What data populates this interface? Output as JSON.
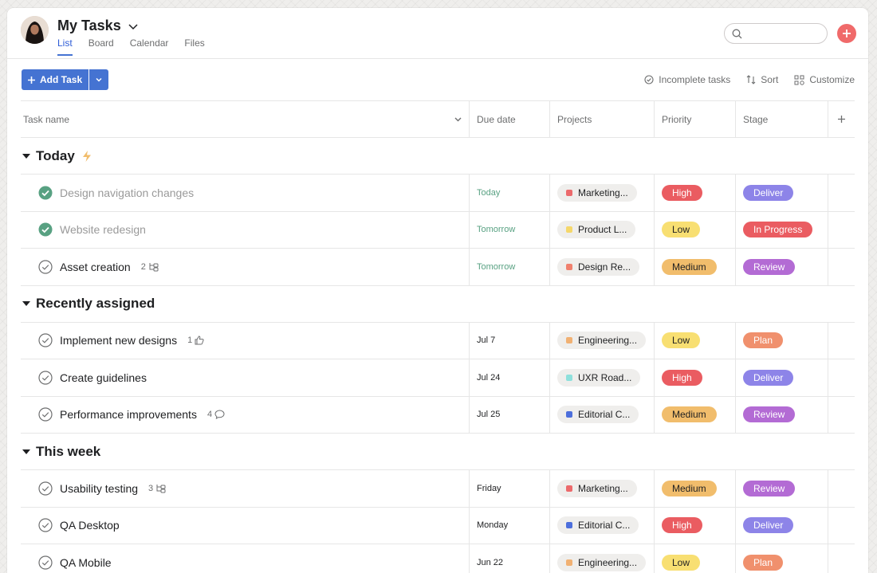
{
  "header": {
    "title": "My Tasks",
    "tabs": [
      "List",
      "Board",
      "Calendar",
      "Files"
    ],
    "active_tab": "List",
    "search_placeholder": ""
  },
  "toolbar": {
    "add_task_label": "Add Task",
    "incomplete_label": "Incomplete tasks",
    "sort_label": "Sort",
    "customize_label": "Customize"
  },
  "columns": {
    "task_name": "Task name",
    "due_date": "Due date",
    "projects": "Projects",
    "priority": "Priority",
    "stage": "Stage"
  },
  "colors": {
    "accent": "#4573d2",
    "add_button": "#f06a6a",
    "done_check": "#58a182"
  },
  "sections": [
    {
      "title": "Today",
      "icon": "lightning-icon",
      "tasks": [
        {
          "name": "Design navigation changes",
          "done": true,
          "meta": "",
          "meta_icon": "",
          "due": "Today",
          "due_green": true,
          "project": "Marketing...",
          "project_color": "#ec6a6c",
          "priority": "High",
          "stage": "Deliver"
        },
        {
          "name": "Website redesign",
          "done": true,
          "meta": "",
          "meta_icon": "",
          "due": "Tomorrow",
          "due_green": true,
          "project": "Product L...",
          "project_color": "#f5d76a",
          "priority": "Low",
          "stage": "In Progress"
        },
        {
          "name": "Asset creation",
          "done": false,
          "meta": "2",
          "meta_icon": "subtask-icon",
          "due": "Tomorrow",
          "due_green": true,
          "project": "Design Re...",
          "project_color": "#f0806d",
          "priority": "Medium",
          "stage": "Review"
        }
      ]
    },
    {
      "title": "Recently assigned",
      "icon": "",
      "tasks": [
        {
          "name": "Implement new designs",
          "done": false,
          "meta": "1",
          "meta_icon": "thumbs-up-icon",
          "due": "Jul 7",
          "due_green": false,
          "project": "Engineering...",
          "project_color": "#f1b173",
          "priority": "Low",
          "stage": "Plan"
        },
        {
          "name": "Create guidelines",
          "done": false,
          "meta": "",
          "meta_icon": "",
          "due": "Jul 24",
          "due_green": false,
          "project": "UXR Road...",
          "project_color": "#8ee0dc",
          "priority": "High",
          "stage": "Deliver"
        },
        {
          "name": "Performance improvements",
          "done": false,
          "meta": "4",
          "meta_icon": "comment-icon",
          "due": "Jul 25",
          "due_green": false,
          "project": "Editorial C...",
          "project_color": "#4d6fdc",
          "priority": "Medium",
          "stage": "Review"
        }
      ]
    },
    {
      "title": "This week",
      "icon": "",
      "tasks": [
        {
          "name": "Usability testing",
          "done": false,
          "meta": "3",
          "meta_icon": "subtask-icon",
          "due": "Friday",
          "due_green": false,
          "project": "Marketing...",
          "project_color": "#ec6a6c",
          "priority": "Medium",
          "stage": "Review"
        },
        {
          "name": "QA Desktop",
          "done": false,
          "meta": "",
          "meta_icon": "",
          "due": "Monday",
          "due_green": false,
          "project": "Editorial C...",
          "project_color": "#4d6fdc",
          "priority": "High",
          "stage": "Deliver"
        },
        {
          "name": "QA Mobile",
          "done": false,
          "meta": "",
          "meta_icon": "",
          "due": "Jun 22",
          "due_green": false,
          "project": "Engineering...",
          "project_color": "#f1b173",
          "priority": "Low",
          "stage": "Plan"
        }
      ]
    }
  ],
  "priority_colors": {
    "High": "#ea5c61",
    "Low": "#f8df72",
    "Medium": "#f1bd6c"
  },
  "stage_colors": {
    "Deliver": "#8d84e8",
    "In Progress": "#ea5c61",
    "Review": "#b36bd4",
    "Plan": "#f0906d"
  }
}
